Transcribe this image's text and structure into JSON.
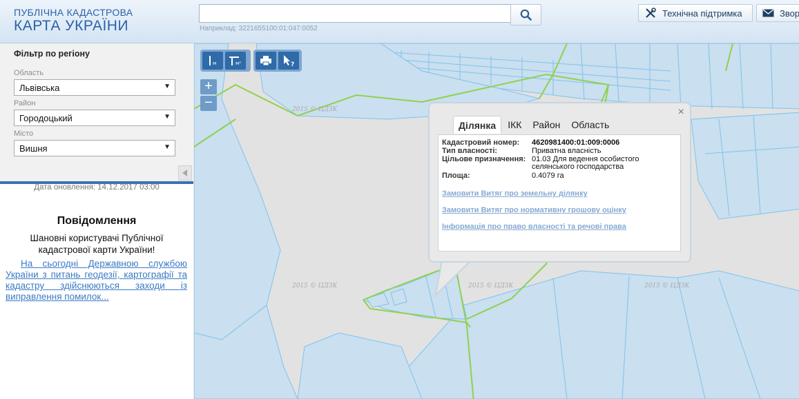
{
  "header": {
    "logo_line1": "ПУБЛІЧНА КАДАСТРОВА",
    "logo_line2": "КАРТА УКРАЇНИ",
    "search_value": "",
    "search_hint": "Наприклад: 3221655100:01:047:0052",
    "support_label": "Технічна підтримка",
    "feedback_label": "Звор"
  },
  "filter": {
    "title": "Фільтр по регіону",
    "oblast_label": "Область",
    "oblast_value": "Львівська",
    "rayon_label": "Район",
    "rayon_value": "Городоцький",
    "city_label": "Місто",
    "city_value": "Вишня"
  },
  "sidebar": {
    "update_text": "Дата оновлення: 14.12.2017 03:00",
    "message_title": "Повідомлення",
    "message_body": "Шановні користувачі Публічної кадастрової карти України!",
    "message_link": "На сьогодні Державною службою України з питань геодезії, картографії та кадастру здійснюються заходи із виправлення помилок..."
  },
  "map": {
    "watermark": "2015 © ЦДЗК",
    "tools": {
      "length_icon_text": "м",
      "area_icon_text": "м²"
    },
    "zoom_in": "+",
    "zoom_out": "−"
  },
  "popup": {
    "close": "×",
    "tabs": [
      "Ділянка",
      "ІКК",
      "Район",
      "Область"
    ],
    "active_tab": "Ділянка",
    "rows": [
      {
        "key": "Кадастровий номер:",
        "value": "4620981400:01:009:0006"
      },
      {
        "key": "Тип власності:",
        "value": "Приватна власність"
      },
      {
        "key": "Цільове призначення:",
        "value": "01.03 Для ведення особистого селянського господарства"
      },
      {
        "key": "Площа:",
        "value": "0.4079 га"
      }
    ],
    "links": [
      "Замовити Витяг про земельну ділянку",
      "Замовити Витяг про нормативну грошову оцінку",
      "Інформація про право власності та речові права"
    ]
  },
  "colors": {
    "brand": "#2a62a8",
    "parcel_fill": "#cadfef",
    "parcel_stroke": "#7ec3ec",
    "boundary": "#8fd14f",
    "toolbar": "#2f6aa9",
    "link": "#3a7ac4"
  }
}
